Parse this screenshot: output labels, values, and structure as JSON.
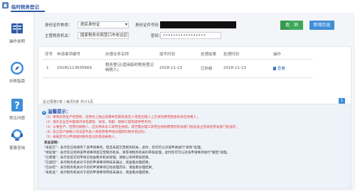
{
  "tab": {
    "title": "临时税务登记"
  },
  "sidebar": {
    "items": [
      {
        "label": "操作说明"
      },
      {
        "label": "办税指南"
      },
      {
        "label": "常见问题"
      },
      {
        "label": "客服咨询"
      }
    ]
  },
  "form": {
    "id_type_label": "身份证件种类：",
    "id_type_value": "居民身份证",
    "id_no_label": "身份证件号码",
    "authority_label": "主管税务机关：",
    "authority_value": "国家税务总局营口市老边区税务局",
    "password_label": "密码：",
    "password_value": "•••••••••••••••••"
  },
  "buttons": {
    "query": "查　询",
    "new": "新增信息"
  },
  "table": {
    "headers": [
      "序号",
      "申请事项编号",
      "办理业务名称",
      "填写时间",
      "处理结果",
      "处理时间",
      "操作"
    ],
    "rows": [
      {
        "no": "1",
        "code": "20181113635669",
        "name": "税务登记(适用临时税务登记纳税人)",
        "fill_time": "2018-11-13",
        "result": "已办结",
        "proc_time": "2018-11-13",
        "action": "查看"
      }
    ]
  },
  "pager": {
    "text": "总记录数1条 / 每页5条 共计1页",
    "page": "1"
  },
  "tips": {
    "title": "温馨提示：",
    "red_lines": [
      "（1）来到达到生产经营权，在税务上独立核算并定期向发包人或者出租人上交承包费或租金的承包承租人；",
      "（2）境外企业在中国境内承包建筑、安装、装配、勘探工程和提供劳务的；",
      "（3）从事生产、经营的纳税人，应办而未办工商营业执照，或无需办理工商营业执照而需经有关部门批准设立但未经有关部门批准的；",
      "（4）非正常户纳税人的法定代表人或经营者申请办理新的税务登记的；",
      "（5）按规定可以申请临时税务登记的其他纳税人。"
    ],
    "status_title": "状态说明:",
    "status_lines": [
      "\"未提交\"：表示您已经保存了该申请事项，但还未提交至税务机关，此时，您可可以对该申请进行\"修改\"处理。",
      "\"待处理\"：表示您已经将该申请事项提交至税务机关，请等待税务机关的审核处理，此时您可可以对该申请事项进行\"撤回\"处理。",
      "\"已受理\"：表示您提交的申请已经由税务机关受理，请耐心等待审核结果。",
      "\"已退回\"：表示税务机关对于您的申请事项审核未通过，请查看办理结果。",
      "\"已办结\"：表示税务机关对于您的申请事项已经处理完毕，请查看办理结果。",
      "\"未批准\"：表示税务机关对于您的申请事项审核未通过，请查看办理结果。"
    ]
  },
  "colors": {
    "accent": "#2d5aa8",
    "query": "#3fa85a",
    "new": "#3f8ed8",
    "warn": "#e23b3b"
  }
}
